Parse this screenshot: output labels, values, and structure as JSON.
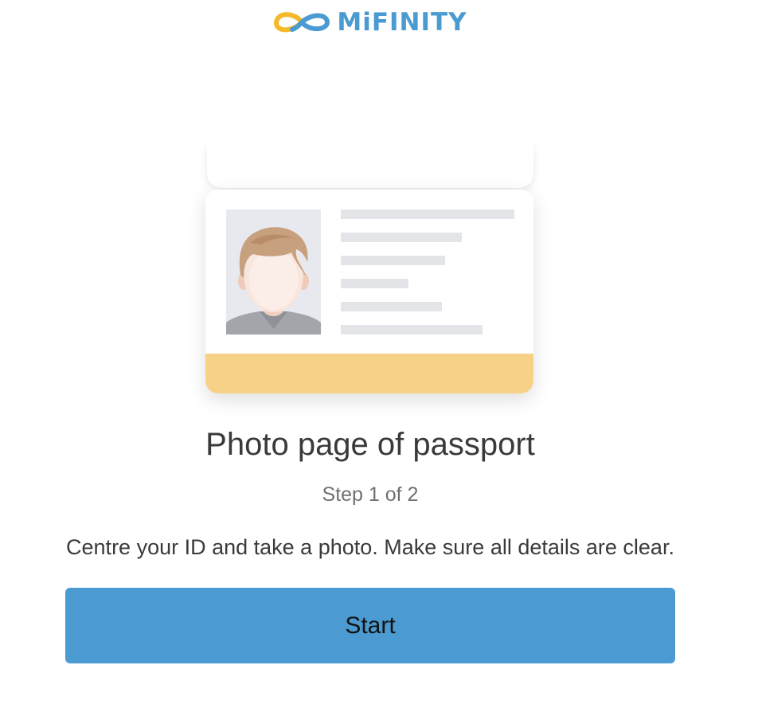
{
  "brand": {
    "name": "MiFINITY",
    "logo_icon": "infinity-logo-icon",
    "color": "#4a9bd1"
  },
  "illustration": {
    "icon": "passport-photo-page-icon",
    "band_color": "#f8d188"
  },
  "title": "Photo page of passport",
  "step": "Step 1 of 2",
  "instructions": "Centre your ID and take a photo. Make sure all details are clear.",
  "start_button": {
    "label": "Start",
    "color": "#4b9bd2"
  }
}
